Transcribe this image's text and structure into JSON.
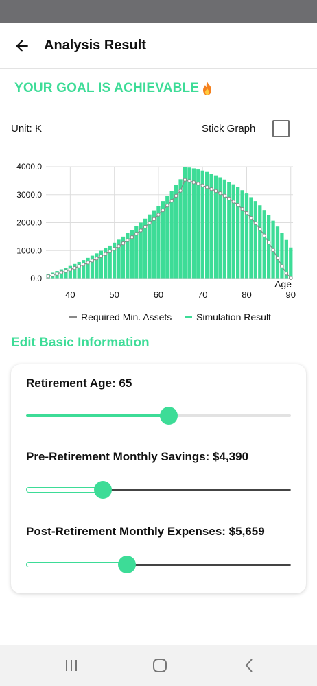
{
  "header": {
    "title": "Analysis Result"
  },
  "goal": {
    "text": "YOUR GOAL IS ACHIEVABLE"
  },
  "unit": {
    "label": "Unit: K"
  },
  "stick_graph": {
    "label": "Stick Graph",
    "checked": false
  },
  "section": {
    "title": "Edit Basic Information"
  },
  "retirement_age": {
    "label": "Retirement Age: 65",
    "level": 0.54
  },
  "pre_savings": {
    "label": "Pre-Retirement Monthly Savings: $4,390",
    "level": 0.29
  },
  "post_expenses": {
    "label": "Post-Retirement Monthly Expenses: $5,659",
    "level": 0.38
  },
  "colors": {
    "accent": "#3ddc97",
    "marker": "#888888",
    "dark_track": "#444444"
  },
  "chart_data": {
    "type": "bar",
    "xlabel": "Age",
    "ylabel": "",
    "xlim": [
      35,
      90
    ],
    "ylim": [
      0,
      4000
    ],
    "x_ticks": [
      "40",
      "50",
      "60",
      "70",
      "80",
      "90"
    ],
    "y_ticks": [
      "0.0",
      "1000.0",
      "2000.0",
      "3000.0",
      "4000.0"
    ],
    "grid": true,
    "legend_position": "bottom",
    "series": [
      {
        "name": "Required Min. Assets",
        "style": "dotted-line",
        "x": [
          35,
          36,
          37,
          38,
          39,
          40,
          41,
          42,
          43,
          44,
          45,
          46,
          47,
          48,
          49,
          50,
          51,
          52,
          53,
          54,
          55,
          56,
          57,
          58,
          59,
          60,
          61,
          62,
          63,
          64,
          65,
          66,
          67,
          68,
          69,
          70,
          71,
          72,
          73,
          74,
          75,
          76,
          77,
          78,
          79,
          80,
          81,
          82,
          83,
          84,
          85,
          86,
          87,
          88,
          89,
          90
        ],
        "values": [
          80,
          120,
          170,
          220,
          270,
          320,
          380,
          440,
          500,
          570,
          640,
          720,
          800,
          880,
          970,
          1060,
          1160,
          1260,
          1370,
          1480,
          1600,
          1720,
          1850,
          1990,
          2130,
          2280,
          2440,
          2610,
          2780,
          2960,
          3140,
          3530,
          3490,
          3440,
          3390,
          3330,
          3270,
          3200,
          3130,
          3050,
          2960,
          2860,
          2750,
          2630,
          2490,
          2340,
          2170,
          1980,
          1770,
          1540,
          1290,
          1020,
          730,
          440,
          180,
          20
        ]
      },
      {
        "name": "Simulation Result",
        "style": "bar",
        "x": [
          35,
          36,
          37,
          38,
          39,
          40,
          41,
          42,
          43,
          44,
          45,
          46,
          47,
          48,
          49,
          50,
          51,
          52,
          53,
          54,
          55,
          56,
          57,
          58,
          59,
          60,
          61,
          62,
          63,
          64,
          65,
          66,
          67,
          68,
          69,
          70,
          71,
          72,
          73,
          74,
          75,
          76,
          77,
          78,
          79,
          80,
          81,
          82,
          83,
          84,
          85,
          86,
          87,
          88,
          89,
          90
        ],
        "values": [
          150,
          210,
          270,
          330,
          390,
          450,
          520,
          590,
          660,
          740,
          820,
          900,
          990,
          1080,
          1180,
          1280,
          1390,
          1500,
          1620,
          1740,
          1870,
          2000,
          2140,
          2290,
          2440,
          2600,
          2770,
          2950,
          3140,
          3340,
          3550,
          3990,
          3970,
          3940,
          3900,
          3860,
          3810,
          3750,
          3690,
          3620,
          3540,
          3460,
          3370,
          3270,
          3160,
          3040,
          2910,
          2770,
          2620,
          2450,
          2270,
          2070,
          1860,
          1630,
          1380,
          1110
        ]
      }
    ]
  }
}
